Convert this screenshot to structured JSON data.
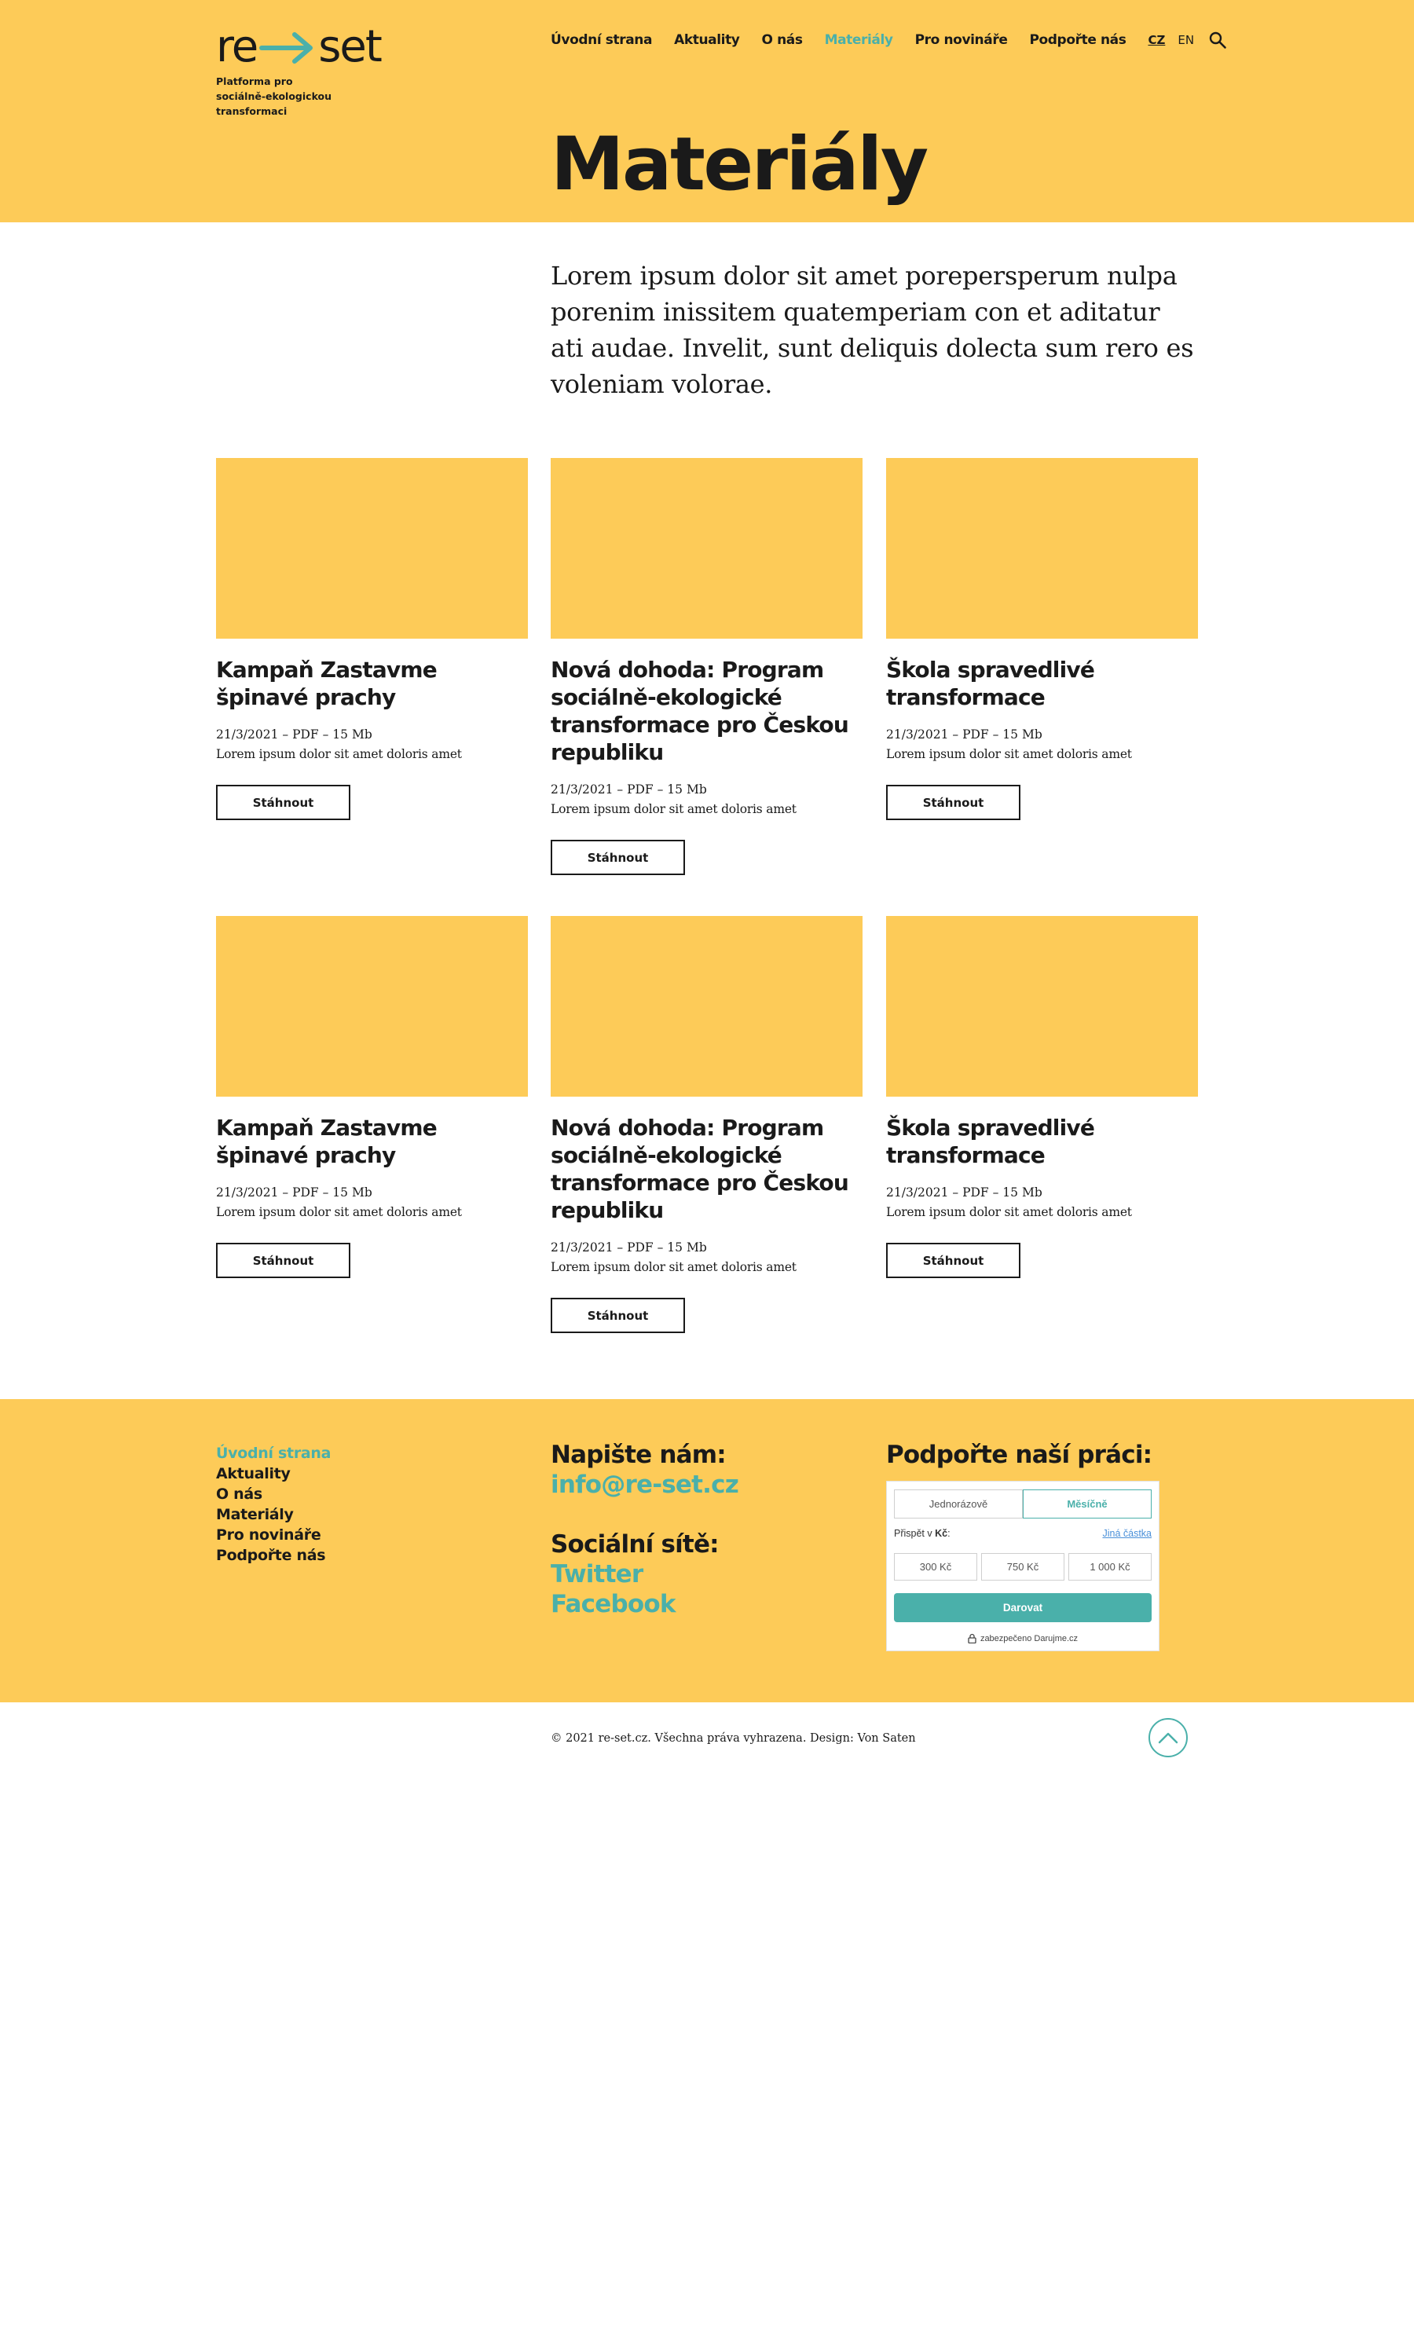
{
  "brand": {
    "logo_left": "re",
    "logo_right": "set",
    "tagline": [
      "Platforma pro",
      "sociálně-ekologickou",
      "transformaci"
    ],
    "accent_color": "#4ab0aa",
    "yellow_color": "#fdcb58"
  },
  "nav": {
    "items": [
      {
        "label": "Úvodní strana"
      },
      {
        "label": "Aktuality"
      },
      {
        "label": "O nás"
      },
      {
        "label": "Materiály",
        "active": true
      },
      {
        "label": "Pro novináře"
      },
      {
        "label": "Podpořte nás"
      }
    ],
    "lang_cz": "CZ",
    "lang_en": "EN",
    "search_icon": "search-icon"
  },
  "page": {
    "title": "Materiály",
    "intro": "Lorem ipsum dolor sit amet porepersperum nulpa porenim inissitem quatemperiam con et aditatur ati audae. Invelit, sunt deliquis dolecta sum rero es voleniam volorae."
  },
  "materials": [
    {
      "title": "Kampaň Zastavme špinavé prachy",
      "meta": "21/3/2021 – PDF – 15 Mb",
      "desc": "Lorem ipsum dolor sit amet doloris amet",
      "button": "Stáhnout"
    },
    {
      "title": "Nová dohoda: Program sociálně-ekologické transformace pro Českou republiku",
      "meta": "21/3/2021 – PDF – 15 Mb",
      "desc": "Lorem ipsum dolor sit amet doloris amet",
      "button": "Stáhnout"
    },
    {
      "title": "Škola spravedlivé transformace",
      "meta": "21/3/2021 – PDF – 15 Mb",
      "desc": "Lorem ipsum dolor sit amet doloris amet",
      "button": "Stáhnout"
    },
    {
      "title": "Kampaň Zastavme špinavé prachy",
      "meta": "21/3/2021 – PDF – 15 Mb",
      "desc": "Lorem ipsum dolor sit amet doloris amet",
      "button": "Stáhnout"
    },
    {
      "title": "Nová dohoda: Program sociálně-ekologické transformace pro Českou republiku",
      "meta": "21/3/2021 – PDF – 15 Mb",
      "desc": "Lorem ipsum dolor sit amet doloris amet",
      "button": "Stáhnout"
    },
    {
      "title": "Škola spravedlivé transformace",
      "meta": "21/3/2021 – PDF – 15 Mb",
      "desc": "Lorem ipsum dolor sit amet doloris amet",
      "button": "Stáhnout"
    }
  ],
  "footer": {
    "links": [
      {
        "label": "Úvodní strana",
        "active": true
      },
      {
        "label": "Aktuality"
      },
      {
        "label": "O nás"
      },
      {
        "label": "Materiály"
      },
      {
        "label": "Pro novináře"
      },
      {
        "label": "Podpořte nás"
      }
    ],
    "write_heading": "Napište nám:",
    "email": "info@re-set.cz",
    "social_heading": "Sociální sítě:",
    "twitter": "Twitter",
    "facebook": "Facebook",
    "support_heading": "Podpořte naší práci:"
  },
  "donation": {
    "tab_once": "Jednorázově",
    "tab_monthly": "Měsíčně",
    "contribute_label_prefix": "Přispět v ",
    "currency": "Kč",
    "contribute_label_suffix": ":",
    "other_amount": "Jiná částka",
    "amounts": [
      "300 Kč",
      "750 Kč",
      "1 000 Kč"
    ],
    "donate_button": "Darovat",
    "secure_text": "zabezpečeno Darujme.cz"
  },
  "copyright": "© 2021 re-set.cz. Všechna práva vyhrazena. Design: Von Saten"
}
